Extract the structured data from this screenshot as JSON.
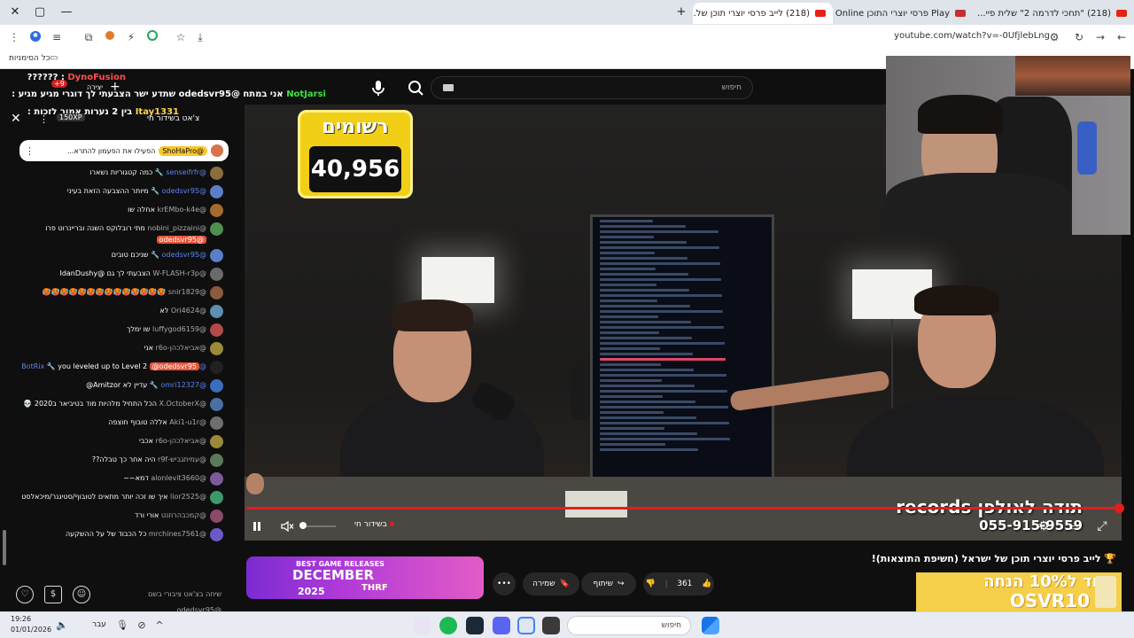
{
  "browser": {
    "tabs": [
      {
        "title": "(218) \"תחכי לדרמה 2\" שלית פיי..."
      },
      {
        "title": "Play פרסי יוצרי התוכן Online | ..."
      },
      {
        "title": "(218) לייב פרסי יוצרי תוכן של..."
      }
    ],
    "url": "youtube.com/watch?v=-0UfjlebLng",
    "bookmarks_label": "כל הסימניות"
  },
  "search": {
    "placeholder": "חיפוש"
  },
  "chat": {
    "overlay": [
      {
        "name": "DynoFusion",
        "text": ": ??????"
      },
      {
        "name": "NotJarsi",
        "text": "אני במתח @odedsvr95 שתדע ישר הצבעתי לך דוגרי מגיע מגיע :"
      },
      {
        "name": "Itay1331",
        "text": "בין 2 נערות אמור לזכות :"
      }
    ],
    "overlay_extra": {
      "plus": "+9",
      "label": "יצירה",
      "badge": "150XP"
    },
    "header": "צ'אט בשידור חי",
    "pinned": {
      "author": "@ShoHaPro",
      "text": "הפעילו את הפעמון להתרא..."
    },
    "messages": [
      {
        "author": "@senseifrfr",
        "text": "כמה קטגוריות נשארו",
        "role": "mod",
        "color": "#8a6d3b"
      },
      {
        "author": "@odedsvr95",
        "text": "מיותר ההצבעה הזאת בעיני",
        "role": "mod",
        "color": "#5b7ec9"
      },
      {
        "author": "@krEMbo-k4e",
        "text": "אחלה שו",
        "role": "",
        "color": "#a36b2d"
      },
      {
        "author": "@nobini_pizzaini",
        "text": "מתי רובלוקס השנה ובריינרוט פרו",
        "role": "",
        "owner": "@odedsvr95",
        "color": "#4f8f4f"
      },
      {
        "author": "@odedsvr95",
        "text": "שניכם טובים",
        "role": "mod",
        "color": "#5b7ec9"
      },
      {
        "author": "@W-FLASH-r3p",
        "text": "הצבעתי לך גם @IdanDushy",
        "role": "",
        "color": "#6a6a6a"
      },
      {
        "author": "@snir1829",
        "text": "🥵🥵🥵🥵🥵🥵🥵🥵🥵🥵🥵🥵🥵🥵",
        "role": "",
        "color": "#8b5a3c"
      },
      {
        "author": "@Ori4624",
        "text": "לא",
        "role": "",
        "color": "#5c8fb2"
      },
      {
        "author": "@luffygod6159",
        "text": "שו ימלך",
        "role": "",
        "color": "#b24a4a"
      },
      {
        "author": "@אביאלכהן-r6o",
        "text": "אני",
        "role": "",
        "color": "#9a8a3a"
      },
      {
        "author": "@BotRix",
        "text": "you leveled up to Level 2",
        "role": "mod",
        "owner": "@odedsvr95",
        "color": "#222222"
      },
      {
        "author": "@omri12327",
        "text": "עדיין לא Amitzor@",
        "role": "mod",
        "color": "#3c6cbf"
      },
      {
        "author": "@X.OctoberX",
        "text": "הכל התחיל מלהיות מוד בטיביאר ב2020 💀",
        "role": "",
        "color": "#4a6fa5"
      },
      {
        "author": "@Aki1-u1r",
        "text": "אללה טובוף חוצפה",
        "role": "",
        "color": "#6f6f6f"
      },
      {
        "author": "@אביאלכהן-r6o",
        "text": "אכבי",
        "role": "",
        "color": "#9a8a3a"
      },
      {
        "author": "@עמיתגביש-r9f",
        "text": "היה אחר כך טבלה??",
        "role": "",
        "color": "#5a7a5a"
      },
      {
        "author": "@alonlevit3660",
        "text": "דמא~~",
        "role": "",
        "color": "#7d5a9a"
      },
      {
        "author": "@lior2525",
        "text": "איך שו זכה יותר מתאים לטובוף/סטיגנר/מיכאלסט",
        "role": "",
        "color": "#3c9a6a"
      },
      {
        "author": "@קמכבהרוזנט",
        "text": "אורי ורד",
        "role": "",
        "color": "#8a4a6a"
      },
      {
        "author": "@mrchines7561",
        "text": "כל הכבוד של על ההשקעה",
        "role": "",
        "color": "#6a5ac9"
      }
    ],
    "input_placeholder": "שיחה בצ'אט ציבורי בשם @odedsvr95..."
  },
  "video": {
    "counter_title": "רשומים",
    "counter_value": "40,956",
    "sponsor_line1": "תודה לאולפן records",
    "sponsor_line2": "055-915-9559",
    "live_label": "בשידור חי",
    "progress": 1.0
  },
  "below": {
    "title": "🏆 לייב פרסי יוצרי תוכן של ישראל (חשיפת התוצאות)!",
    "like_count": "361",
    "share_label": "שיתוף",
    "save_label": "שמירה",
    "promo_line1": "קוד ל10% הנחה",
    "promo_line2": "OSVR10",
    "thumb": {
      "line1": "BEST GAME RELEASES",
      "line2": "DECEMBER",
      "line3": "2025",
      "line4": "THRF"
    }
  },
  "taskbar": {
    "time": "19:26",
    "date": "01/01/2026",
    "lang": "עבר",
    "search": "חיפוש"
  }
}
